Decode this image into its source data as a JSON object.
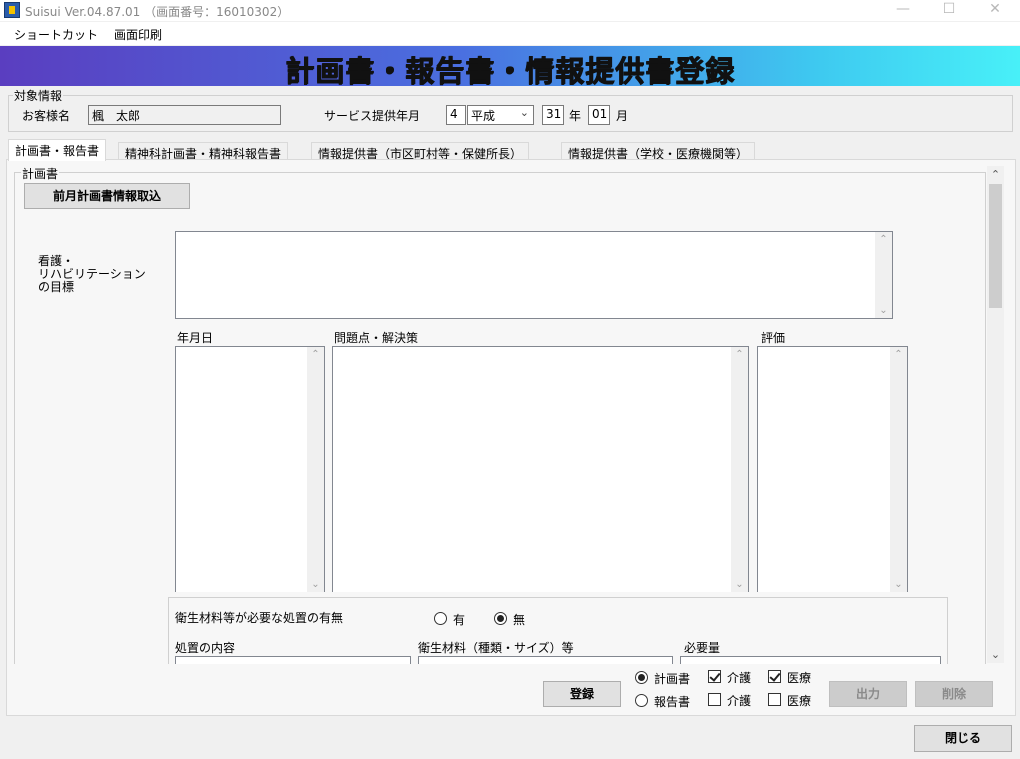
{
  "window": {
    "title": "Suisui Ver.04.87.01 （画面番号：16010302）",
    "minimize": "—",
    "maximize": "☐",
    "close": "✕"
  },
  "menu": {
    "shortcut": "ショートカット",
    "print": "画面印刷"
  },
  "banner": {
    "title": "計画書・報告書・情報提供書登録"
  },
  "target": {
    "legend": "対象情報",
    "customer_label": "お客様名",
    "customer_value": "楓　太郎",
    "service_label": "サービス提供年月",
    "era_num": "4",
    "era_name": "平成",
    "year_value": "31",
    "year_unit": "年",
    "month_value": "01",
    "month_unit": "月"
  },
  "tabs": [
    {
      "label": "計画書・報告書"
    },
    {
      "label": "精神科計画書・精神科報告書"
    },
    {
      "label": "情報提供書（市区町村等・保健所長）"
    },
    {
      "label": "情報提供書（学校・医療機関等）"
    }
  ],
  "plan": {
    "legend": "計画書",
    "import_button": "前月計画書情報取込",
    "goal_label": "看護・\nリハビリテーション\nの目標",
    "col_date": "年月日",
    "col_problem": "問題点・解決策",
    "col_eval": "評価",
    "supplies_question": "衛生材料等が必要な処置の有無",
    "opt_yes": "有",
    "opt_no": "無",
    "col_treatment": "処置の内容",
    "col_material": "衛生材料（種類・サイズ）等",
    "col_amount": "必要量"
  },
  "footer": {
    "register": "登録",
    "radio_plan": "計画書",
    "radio_report": "報告書",
    "kaigo": "介護",
    "iryo": "医療",
    "output": "出力",
    "delete": "削除",
    "close": "閉じる"
  }
}
